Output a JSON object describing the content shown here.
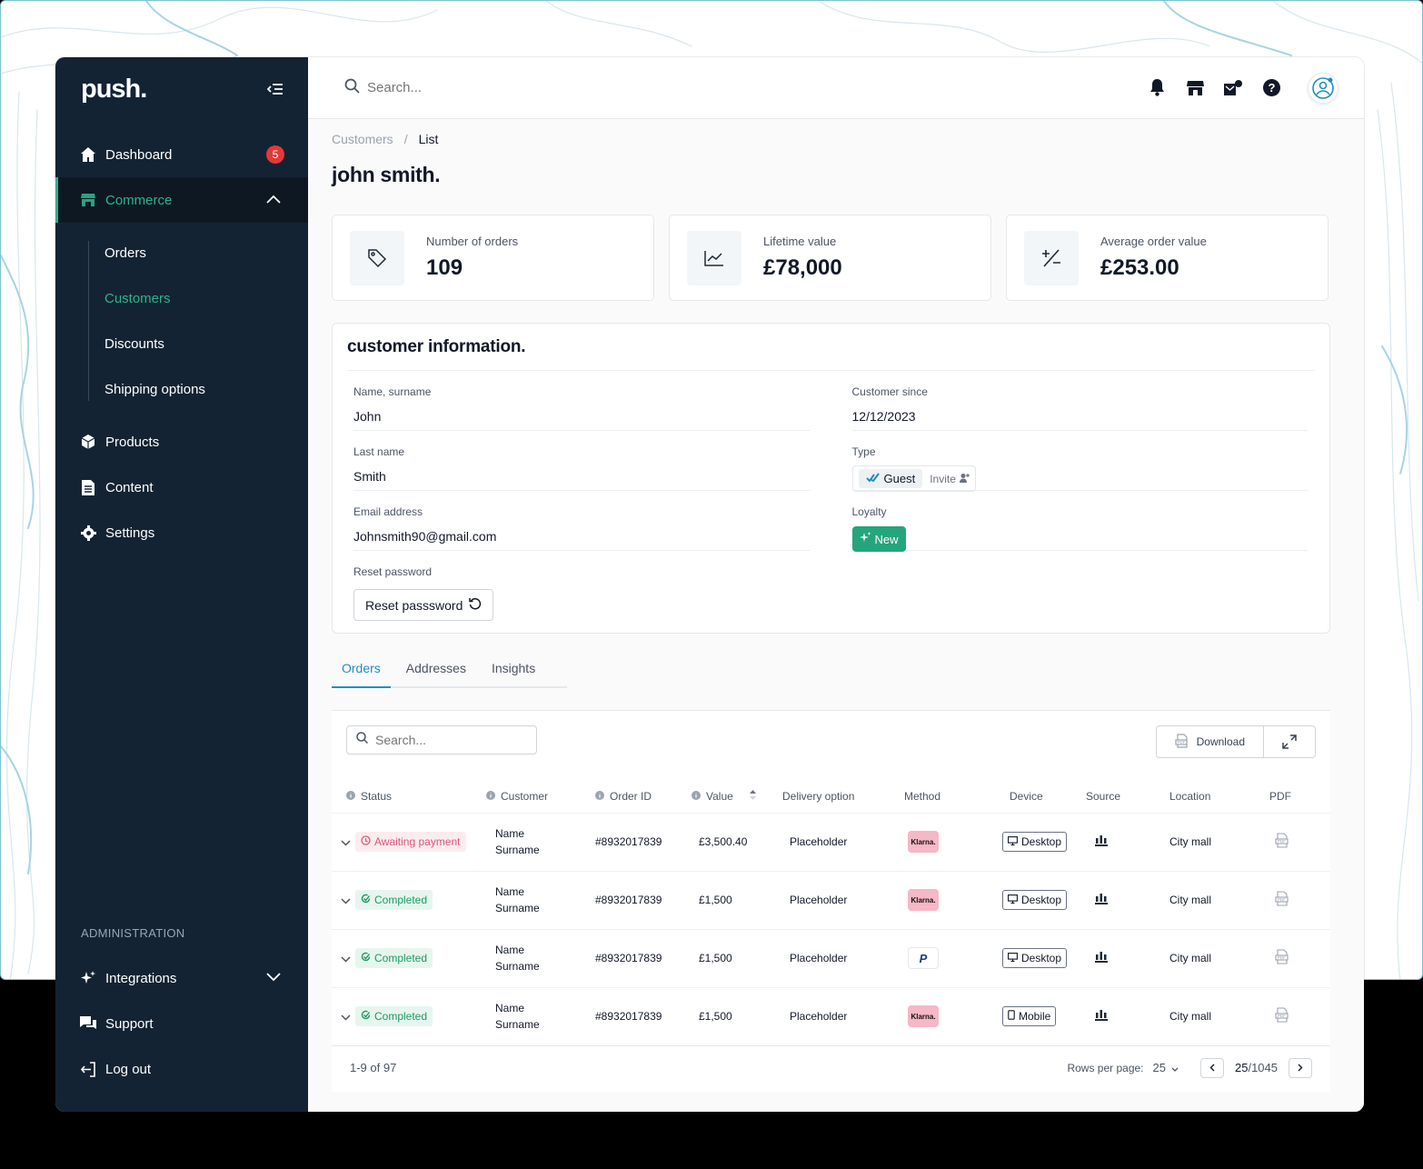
{
  "brand": {
    "logo": "push."
  },
  "sidebar": {
    "dashboard": {
      "label": "Dashboard",
      "badge": "5",
      "icon": "home-icon"
    },
    "commerce": {
      "label": "Commerce",
      "icon": "store-icon"
    },
    "commerce_sub": [
      "Orders",
      "Customers",
      "Discounts",
      "Shipping options"
    ],
    "products": {
      "label": "Products",
      "icon": "box-icon"
    },
    "content": {
      "label": "Content",
      "icon": "document-icon"
    },
    "settings": {
      "label": "Settings",
      "icon": "gear-icon"
    },
    "admin_label": "ADMINISTRATION",
    "integrations": {
      "label": "Integrations",
      "icon": "sparkle-icon"
    },
    "support": {
      "label": "Support",
      "icon": "chat-icon"
    },
    "logout": {
      "label": "Log out",
      "icon": "logout-icon"
    }
  },
  "topbar": {
    "search_placeholder": "Search..."
  },
  "breadcrumb": {
    "parent": "Customers",
    "sep": "/",
    "current": "List"
  },
  "page_title": "john smith.",
  "stats": [
    {
      "label": "Number of orders",
      "value": "109",
      "icon": "tag-icon"
    },
    {
      "label": "Lifetime value",
      "value": "£78,000",
      "icon": "chart-line-icon"
    },
    {
      "label": "Average order value",
      "value": "£253.00",
      "icon": "plus-minus-icon"
    }
  ],
  "info": {
    "title": "customer information.",
    "name_label": "Name, surname",
    "name_value": "John",
    "last_label": "Last name",
    "last_value": "Smith",
    "email_label": "Email address",
    "email_value": "Johnsmith90@gmail.com",
    "reset_label": "Reset password",
    "reset_button": "Reset passsword",
    "since_label": "Customer since",
    "since_value": "12/12/2023",
    "type_label": "Type",
    "type_guest": "Guest",
    "type_invite": "Invite",
    "loyalty_label": "Loyalty",
    "loyalty_value": "New"
  },
  "tabs": [
    "Orders",
    "Addresses",
    "Insights"
  ],
  "table": {
    "search_placeholder": "Search...",
    "download_label": "Download",
    "headers": [
      "Status",
      "Customer",
      "Order ID",
      "Value",
      "Delivery option",
      "Method",
      "Device",
      "Source",
      "Location",
      "PDF"
    ],
    "rows": [
      {
        "status": "Awaiting payment",
        "kind": "await",
        "customer1": "Name",
        "customer2": "Surname",
        "order": "#8932017839",
        "value": "£3,500.40",
        "delivery": "Placeholder",
        "method": "Klarna.",
        "device": "Desktop",
        "location": "City mall"
      },
      {
        "status": "Completed",
        "kind": "done",
        "customer1": "Name",
        "customer2": "Surname",
        "order": "#8932017839",
        "value": "£1,500",
        "delivery": "Placeholder",
        "method": "Klarna.",
        "device": "Desktop",
        "location": "City mall"
      },
      {
        "status": "Completed",
        "kind": "done",
        "customer1": "Name",
        "customer2": "Surname",
        "order": "#8932017839",
        "value": "£1,500",
        "delivery": "Placeholder",
        "method": "P",
        "device": "Desktop",
        "location": "City mall"
      },
      {
        "status": "Completed",
        "kind": "done",
        "customer1": "Name",
        "customer2": "Surname",
        "order": "#8932017839",
        "value": "£1,500",
        "delivery": "Placeholder",
        "method": "Klarna.",
        "device": "Mobile",
        "location": "City mall"
      }
    ],
    "footer_range": "1-9 of 97",
    "rows_per_page_label": "Rows per page:",
    "rows_per_page_value": "25",
    "page_current": "25",
    "page_total": "/1045"
  },
  "colors": {
    "accent": "#2bb389",
    "sidebar": "#142333",
    "tab_active": "#1f8fc0"
  }
}
